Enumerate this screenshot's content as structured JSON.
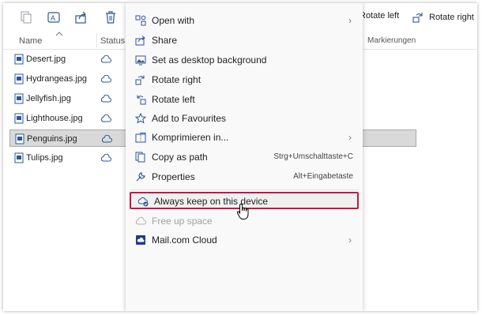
{
  "toolbar": {
    "rotate_left_label": "Rotate left",
    "rotate_right_label": "Rotate right"
  },
  "header": {
    "name": "Name",
    "status": "Status",
    "markierungen": "Markierungen"
  },
  "files": [
    {
      "name": "Desert.jpg",
      "status": "cloud-icon"
    },
    {
      "name": "Hydrangeas.jpg",
      "status": "cloud-icon"
    },
    {
      "name": "Jellyfish.jpg",
      "status": "cloud-icon"
    },
    {
      "name": "Lighthouse.jpg",
      "status": "cloud-icon"
    },
    {
      "name": "Penguins.jpg",
      "status": "cloud-icon",
      "selected": true
    },
    {
      "name": "Tulips.jpg",
      "status": "cloud-icon"
    }
  ],
  "context_menu": {
    "open_with": "Open with",
    "share": "Share",
    "set_desktop": "Set as desktop background",
    "rotate_right": "Rotate right",
    "rotate_left": "Rotate left",
    "add_favourites": "Add to Favourites",
    "komprimieren": "Komprimieren in...",
    "copy_path": "Copy as path",
    "copy_path_shortcut": "Strg+Umschalttaste+C",
    "properties": "Properties",
    "properties_shortcut": "Alt+Eingabetaste",
    "always_keep": "Always keep on this device",
    "free_up": "Free up space",
    "mail_cloud": "Mail.com Cloud"
  },
  "colors": {
    "accent": "#2b5797",
    "highlight_border": "#c8173e"
  }
}
